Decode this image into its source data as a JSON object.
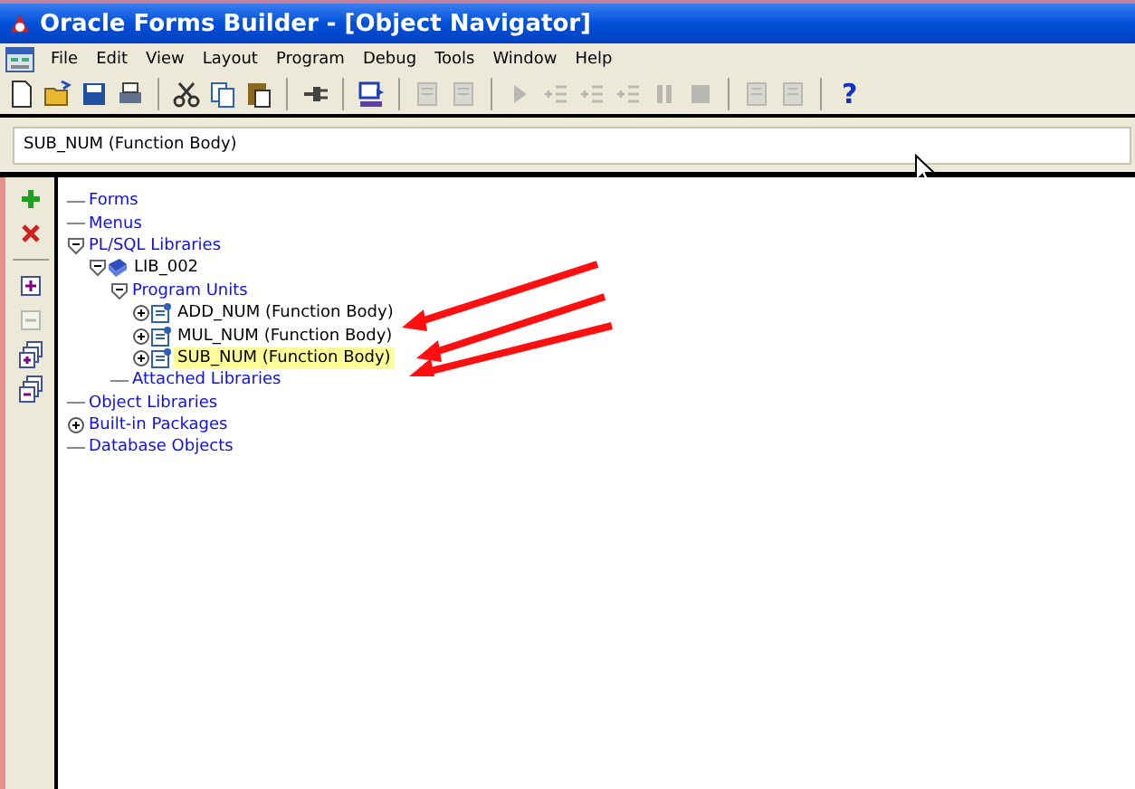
{
  "window": {
    "title": "Oracle Forms Builder - [Object Navigator]"
  },
  "menu": [
    "File",
    "Edit",
    "View",
    "Layout",
    "Program",
    "Debug",
    "Tools",
    "Window",
    "Help"
  ],
  "toolbar": [
    {
      "kind": "new",
      "disabled": false
    },
    {
      "kind": "open",
      "disabled": false
    },
    {
      "kind": "save",
      "disabled": false
    },
    {
      "kind": "print",
      "disabled": false
    },
    {
      "kind": "sep"
    },
    {
      "kind": "cut",
      "disabled": false
    },
    {
      "kind": "copy",
      "disabled": false
    },
    {
      "kind": "paste",
      "disabled": false
    },
    {
      "kind": "sep"
    },
    {
      "kind": "connect",
      "disabled": false
    },
    {
      "kind": "sep"
    },
    {
      "kind": "run",
      "disabled": false
    },
    {
      "kind": "sep"
    },
    {
      "kind": "trash",
      "disabled": true
    },
    {
      "kind": "compile",
      "disabled": true
    },
    {
      "kind": "sep"
    },
    {
      "kind": "play",
      "disabled": true
    },
    {
      "kind": "step",
      "disabled": true
    },
    {
      "kind": "step",
      "disabled": true
    },
    {
      "kind": "step",
      "disabled": true
    },
    {
      "kind": "pause",
      "disabled": true
    },
    {
      "kind": "stop",
      "disabled": true
    },
    {
      "kind": "sep"
    },
    {
      "kind": "compile",
      "disabled": true
    },
    {
      "kind": "compile",
      "disabled": true
    },
    {
      "kind": "sep"
    },
    {
      "kind": "help",
      "label": "?",
      "disabled": false
    }
  ],
  "context": {
    "value": "SUB_NUM (Function Body)"
  },
  "side_tools": [
    {
      "kind": "add",
      "disabled": false
    },
    {
      "kind": "delete",
      "disabled": false
    },
    {
      "kind": "sep"
    },
    {
      "kind": "expand",
      "disabled": false
    },
    {
      "kind": "collapse",
      "disabled": true
    },
    {
      "kind": "expand-all",
      "disabled": false
    },
    {
      "kind": "collapse-all",
      "disabled": false
    }
  ],
  "tree": [
    {
      "label": "Forms",
      "kind": "category",
      "selected": false
    },
    {
      "label": "Menus",
      "kind": "category",
      "selected": false
    },
    {
      "label": "PL/SQL Libraries",
      "kind": "category",
      "expanded": true,
      "selected": false,
      "children": [
        {
          "label": "LIB_002",
          "kind": "library",
          "expanded": true,
          "selected": false,
          "children": [
            {
              "label": "Program Units",
              "kind": "category",
              "expanded": true,
              "selected": false,
              "children": [
                {
                  "label": "ADD_NUM (Function Body)",
                  "kind": "unit",
                  "expanded": false,
                  "selected": false
                },
                {
                  "label": "MUL_NUM (Function Body)",
                  "kind": "unit",
                  "expanded": false,
                  "selected": false
                },
                {
                  "label": "SUB_NUM (Function Body)",
                  "kind": "unit",
                  "expanded": false,
                  "selected": true
                }
              ]
            },
            {
              "label": "Attached Libraries",
              "kind": "category",
              "selected": false
            }
          ]
        }
      ]
    },
    {
      "label": "Object Libraries",
      "kind": "category",
      "selected": false
    },
    {
      "label": "Built-in Packages",
      "kind": "category",
      "expanded": false,
      "selected": false
    },
    {
      "label": "Database Objects",
      "kind": "category",
      "selected": false
    }
  ]
}
